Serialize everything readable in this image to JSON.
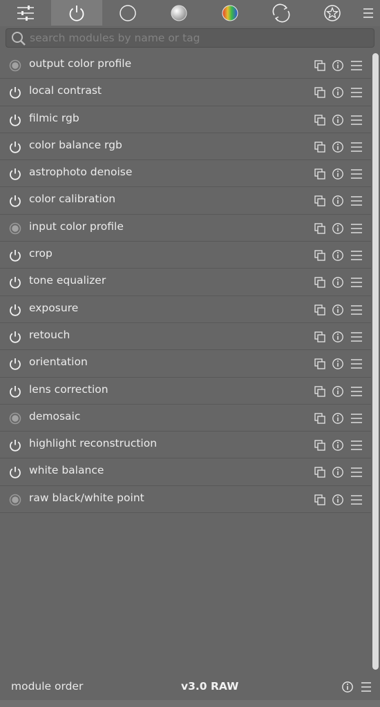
{
  "tabs": [
    {
      "icon": "sliders-icon",
      "active": false
    },
    {
      "icon": "power-icon",
      "active": true
    },
    {
      "icon": "circle-icon",
      "active": false
    },
    {
      "icon": "gray-ball-icon",
      "active": false
    },
    {
      "icon": "color-ball-icon",
      "active": false
    },
    {
      "icon": "refresh-icon",
      "active": false
    },
    {
      "icon": "star-badge-icon",
      "active": false
    }
  ],
  "search": {
    "placeholder": "search modules by name or tag",
    "value": ""
  },
  "modules": [
    {
      "label": "output color profile",
      "state": "always-on"
    },
    {
      "label": "local contrast",
      "state": "power"
    },
    {
      "label": "filmic rgb",
      "state": "power"
    },
    {
      "label": "color balance rgb",
      "state": "power"
    },
    {
      "label": "astrophoto denoise",
      "state": "power"
    },
    {
      "label": "color calibration",
      "state": "power"
    },
    {
      "label": "input color profile",
      "state": "always-on"
    },
    {
      "label": "crop",
      "state": "power"
    },
    {
      "label": "tone equalizer",
      "state": "power"
    },
    {
      "label": "exposure",
      "state": "power"
    },
    {
      "label": "retouch",
      "state": "power"
    },
    {
      "label": "orientation",
      "state": "power"
    },
    {
      "label": "lens correction",
      "state": "power"
    },
    {
      "label": "demosaic",
      "state": "always-on"
    },
    {
      "label": "highlight reconstruction",
      "state": "power"
    },
    {
      "label": "white balance",
      "state": "power"
    },
    {
      "label": "raw black/white point",
      "state": "always-on"
    }
  ],
  "footer": {
    "module_order_label": "module order",
    "version": "v3.0 RAW"
  },
  "colors": {
    "background": "#666666",
    "active_tab": "#7c7c7c",
    "text": "#ececec",
    "icon": "#f0f0f0"
  }
}
